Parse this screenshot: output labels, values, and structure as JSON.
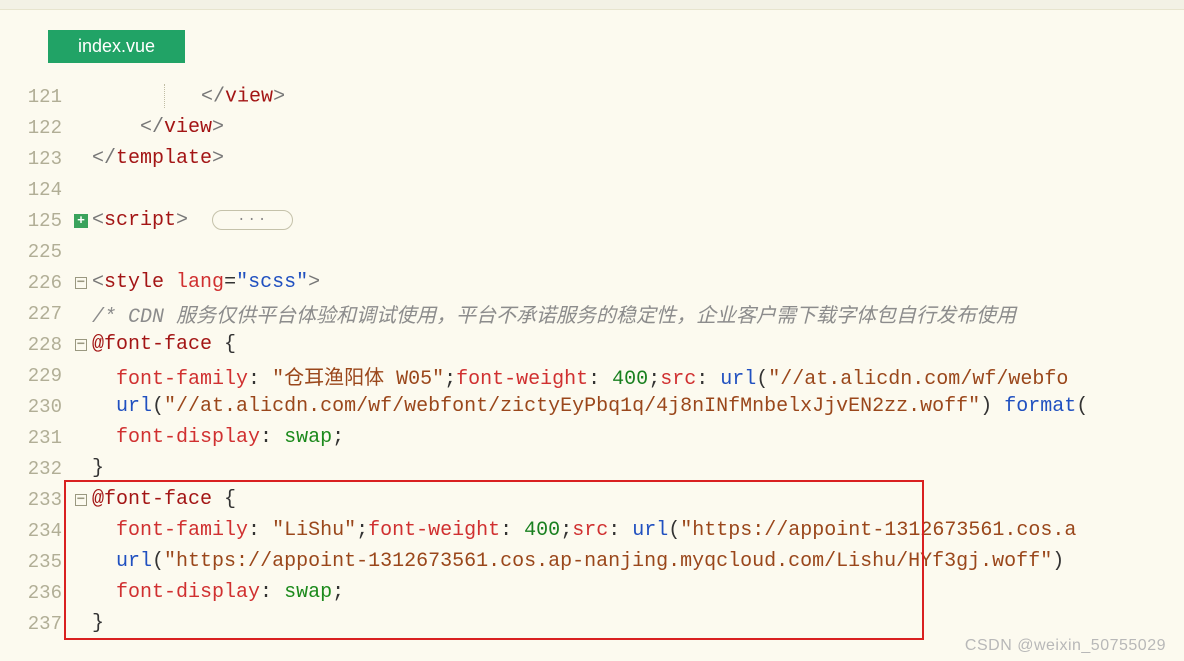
{
  "tab": {
    "title": "index.vue"
  },
  "lines": {
    "l121": "121",
    "l122": "122",
    "l123": "123",
    "l124": "124",
    "l125": "125",
    "l225": "225",
    "l226": "226",
    "l227": "227",
    "l228": "228",
    "l229": "229",
    "l230": "230",
    "l231": "231",
    "l232": "232",
    "l233": "233",
    "l234": "234",
    "l235": "235",
    "l236": "236",
    "l237": "237"
  },
  "tags": {
    "view_close": "view",
    "template_close": "template",
    "script_open": "script",
    "style_open": "style"
  },
  "style": {
    "lang_attr": "lang",
    "lang_val": "\"scss\""
  },
  "fold": {
    "dots": "···"
  },
  "comment": {
    "cdn": "/* CDN 服务仅供平台体验和调试使用，平台不承诺服务的稳定性，企业客户需下载字体包自行发布使用"
  },
  "atrule": {
    "fontface": "@font-face"
  },
  "css": {
    "font_family_key": "font-family",
    "ff_val_1": "\"仓耳渔阳体 W05\"",
    "ff_val_2": "\"LiShu\"",
    "font_weight_key": "font-weight",
    "fw_val": "400",
    "src_key": "src",
    "url_fn": "url",
    "url1": "\"//at.alicdn.com/wf/webfo",
    "url2": "\"//at.alicdn.com/wf/webfont/zictyEyPbq1q/4j8nINfMnbelxJjvEN2zz.woff\"",
    "url3": "\"https://appoint-1312673561.cos.a",
    "url4": "\"https://appoint-1312673561.cos.ap-nanjing.myqcloud.com/Lishu/HYf3gj.woff\"",
    "format_fn": "format",
    "font_display_key": "font-display",
    "fd_val": "swap"
  },
  "watermark": "CSDN @weixin_50755029"
}
